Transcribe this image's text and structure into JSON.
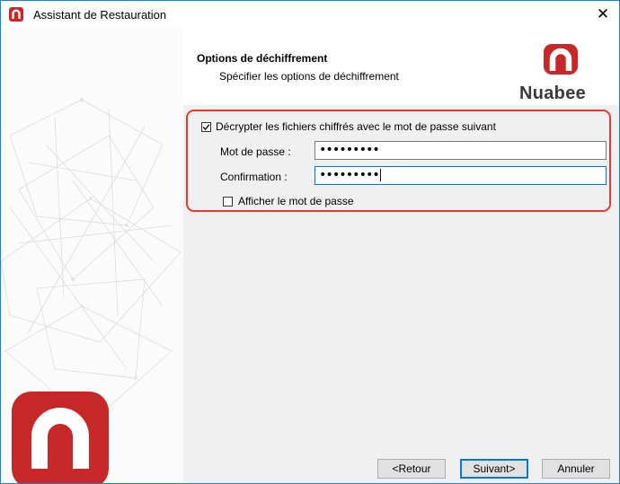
{
  "window": {
    "title": "Assistant de Restauration"
  },
  "header": {
    "title": "Options de déchiffrement",
    "subtitle": "Spécifier les options de déchiffrement",
    "brand": "Nuabee"
  },
  "options": {
    "decrypt_label": "Décrypter les fichiers chiffrés avec le mot de passe suivant",
    "decrypt_checked": true,
    "password_label": "Mot de passe :",
    "password_value": "•••••••••",
    "confirm_label": "Confirmation :",
    "confirm_value": "•••••••••",
    "show_password_label": "Afficher le mot de passe",
    "show_password_checked": false
  },
  "buttons": {
    "back": "<Retour",
    "next": "Suivant>",
    "cancel": "Annuler"
  },
  "colors": {
    "brand": "#c62828",
    "highlight": "#e53935",
    "accent": "#0078d7"
  },
  "icons": {
    "close": "close-icon",
    "app": "nuabee-logo-icon",
    "check": "check-icon"
  }
}
